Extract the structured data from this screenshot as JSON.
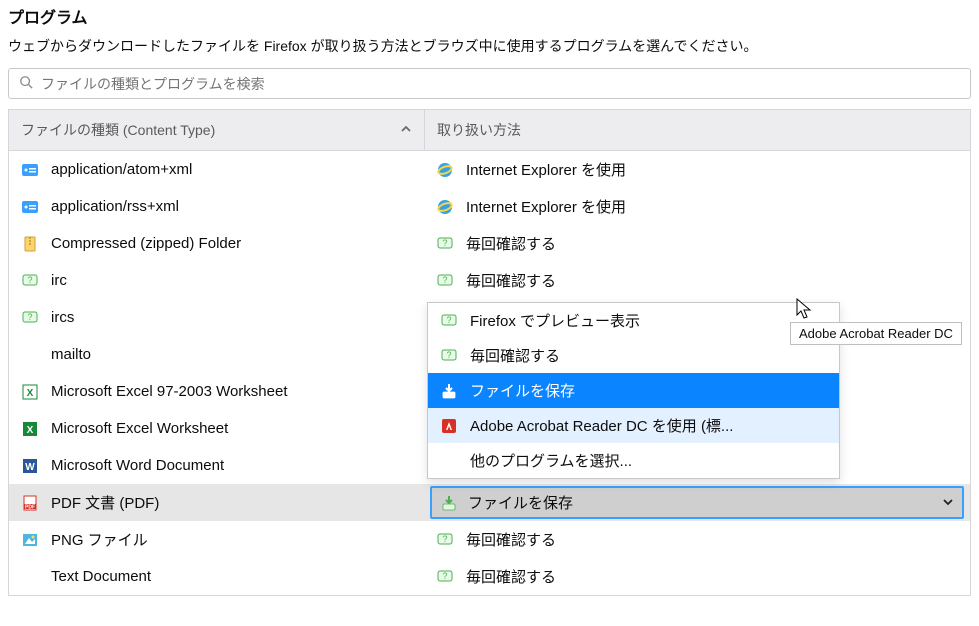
{
  "header": {
    "title": "プログラム",
    "description": "ウェブからダウンロードしたファイルを Firefox が取り扱う方法とブラウズ中に使用するプログラムを選んでください。"
  },
  "search": {
    "placeholder": "ファイルの種類とプログラムを検索"
  },
  "columns": {
    "content_type": "ファイルの種類 (Content Type)",
    "action": "取り扱い方法"
  },
  "rows": [
    {
      "type_icon": "feed",
      "type_label": "application/atom+xml",
      "action_icon": "ie",
      "action_label": "Internet Explorer を使用"
    },
    {
      "type_icon": "feed",
      "type_label": "application/rss+xml",
      "action_icon": "ie",
      "action_label": "Internet Explorer を使用"
    },
    {
      "type_icon": "zip",
      "type_label": "Compressed (zipped) Folder",
      "action_icon": "ask",
      "action_label": "毎回確認する"
    },
    {
      "type_icon": "chat",
      "type_label": "irc",
      "action_icon": "ask",
      "action_label": "毎回確認する"
    },
    {
      "type_icon": "chat",
      "type_label": "ircs",
      "action_icon": "",
      "action_label": ""
    },
    {
      "type_icon": "blank",
      "type_label": "mailto",
      "action_icon": "",
      "action_label": ""
    },
    {
      "type_icon": "excel",
      "type_label": "Microsoft Excel 97-2003 Worksheet",
      "action_icon": "",
      "action_label": ""
    },
    {
      "type_icon": "excelx",
      "type_label": "Microsoft Excel Worksheet",
      "action_icon": "",
      "action_label": ""
    },
    {
      "type_icon": "word",
      "type_label": "Microsoft Word Document",
      "action_icon": "",
      "action_label": ""
    },
    {
      "type_icon": "pdf",
      "type_label": "PDF 文書 (PDF)",
      "action_icon": "save",
      "action_label": "ファイルを保存",
      "selected": true
    },
    {
      "type_icon": "png",
      "type_label": "PNG ファイル",
      "action_icon": "ask",
      "action_label": "毎回確認する"
    },
    {
      "type_icon": "blank",
      "type_label": "Text Document",
      "action_icon": "ask",
      "action_label": "毎回確認する"
    }
  ],
  "popup": [
    {
      "icon": "ask",
      "label": "Firefox でプレビュー表示"
    },
    {
      "icon": "ask",
      "label": "毎回確認する"
    },
    {
      "icon": "save",
      "label": "ファイルを保存",
      "style": "highlight-save"
    },
    {
      "icon": "adobe",
      "label": "Adobe Acrobat Reader DC  を使用 (標...",
      "style": "hover-adobe"
    },
    {
      "icon": "blank",
      "label": "他のプログラムを選択..."
    }
  ],
  "tooltip": "Adobe Acrobat Reader DC"
}
